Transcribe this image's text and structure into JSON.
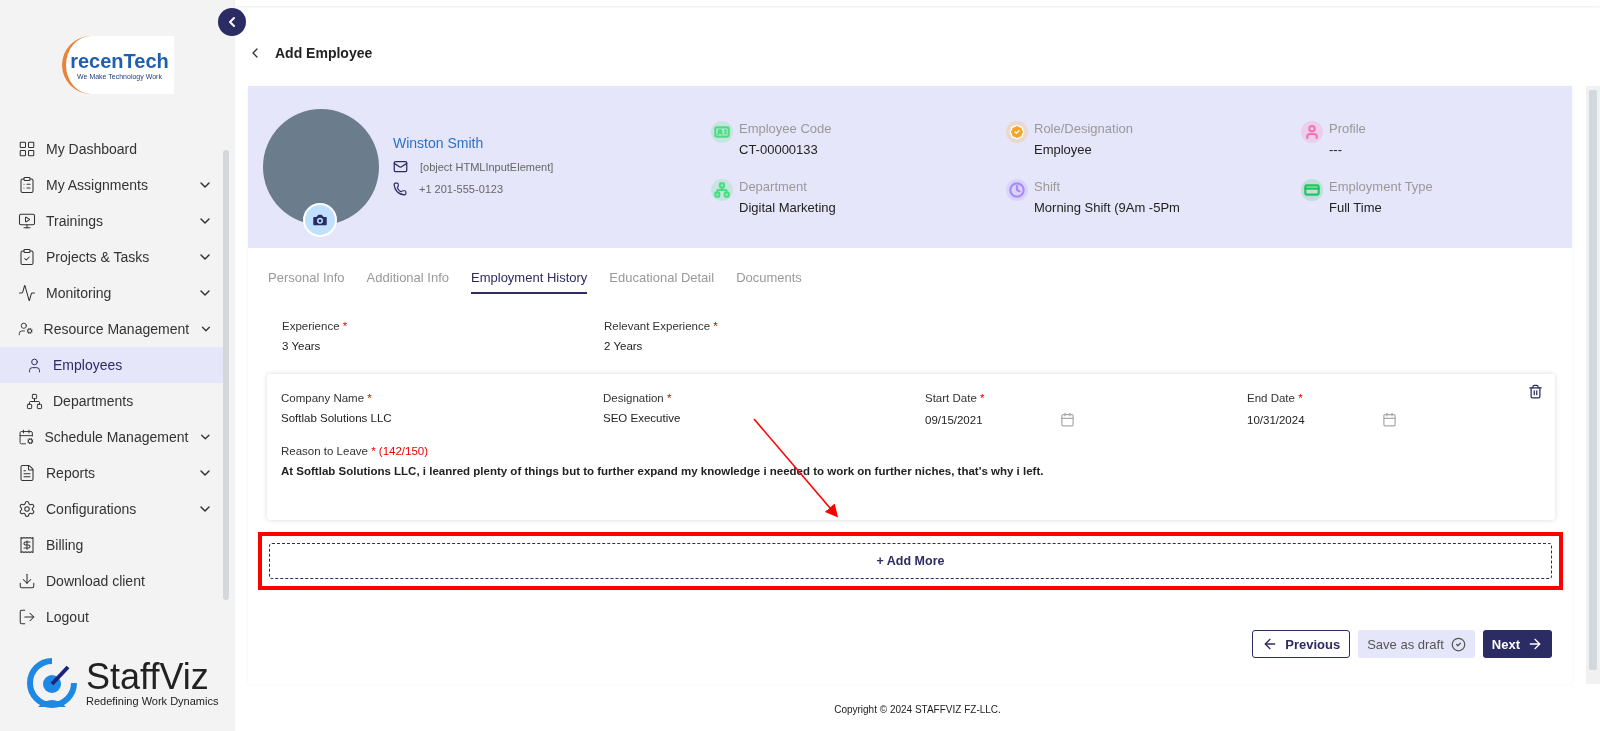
{
  "sidebar": {
    "logo": {
      "brand": "recenTech",
      "tagline": "We Make Technology Work"
    },
    "items": [
      {
        "label": "My Dashboard",
        "expandable": false,
        "selected": false
      },
      {
        "label": "My Assignments",
        "expandable": true,
        "selected": false
      },
      {
        "label": "Trainings",
        "expandable": true,
        "selected": false
      },
      {
        "label": "Projects & Tasks",
        "expandable": true,
        "selected": false
      },
      {
        "label": "Monitoring",
        "expandable": true,
        "selected": false
      },
      {
        "label": "Resource Management",
        "expandable": true,
        "expanded": true,
        "selected": false,
        "children": [
          {
            "label": "Employees",
            "selected": true
          },
          {
            "label": "Departments",
            "selected": false
          }
        ]
      },
      {
        "label": "Schedule Management",
        "expandable": true,
        "selected": false
      },
      {
        "label": "Reports",
        "expandable": true,
        "selected": false
      },
      {
        "label": "Configurations",
        "expandable": true,
        "selected": false
      },
      {
        "label": "Billing",
        "expandable": false,
        "selected": false
      },
      {
        "label": "Download client",
        "expandable": false,
        "selected": false
      },
      {
        "label": "Logout",
        "expandable": false,
        "selected": false
      }
    ],
    "footer_logo": {
      "brand": "StaffViz",
      "tagline": "Redefining Work Dynamics"
    }
  },
  "page": {
    "title": "Add Employee"
  },
  "profile": {
    "name": "Winston Smith",
    "email": "[object HTMLInputElement]",
    "phone": "+1 201-555-0123",
    "fields": [
      {
        "label": "Employee Code",
        "value": "CT-00000133",
        "color": "#4ade80"
      },
      {
        "label": "Role/Designation",
        "value": "Employee",
        "color": "#f5a524"
      },
      {
        "label": "Profile",
        "value": "---",
        "color": "#f472b6"
      },
      {
        "label": "Department",
        "value": "Digital Marketing",
        "color": "#4ade80"
      },
      {
        "label": "Shift",
        "value": "Morning Shift (9Am -5Pm",
        "color": "#a78bfa"
      },
      {
        "label": "Employment Type",
        "value": "Full Time",
        "color": "#22c55e"
      }
    ]
  },
  "tabs": [
    {
      "label": "Personal Info",
      "selected": false
    },
    {
      "label": "Additional Info",
      "selected": false
    },
    {
      "label": "Employment History",
      "selected": true
    },
    {
      "label": "Educational Detail",
      "selected": false
    },
    {
      "label": "Documents",
      "selected": false
    }
  ],
  "experience": [
    {
      "label": "Experience",
      "mark": "*",
      "value": "3 Years"
    },
    {
      "label": "Relevant Experience",
      "mark": "*",
      "value": "2 Years"
    }
  ],
  "history": [
    {
      "fields": [
        {
          "label": "Company Name",
          "mark": "*",
          "value": "Softlab Solutions LLC",
          "kind": "text"
        },
        {
          "label": "Designation",
          "mark": "*",
          "value": "SEO Executive",
          "kind": "text"
        },
        {
          "label": "Start Date",
          "mark": "*",
          "value": "09/15/2021",
          "kind": "date"
        },
        {
          "label": "End Date",
          "mark": "*",
          "value": "10/31/2024",
          "kind": "date"
        }
      ],
      "reason": {
        "label": "Reason to Leave",
        "mark": "*",
        "counter": "(142/150)",
        "value": "At Softlab Solutions LLC, i leanred plenty of things but to further expand my knowledge i needed to work on further niches, that's why i left."
      }
    }
  ],
  "add_more": "+ Add More",
  "actions": {
    "previous": "Previous",
    "draft": "Save as draft",
    "next": "Next"
  },
  "copyright": "Copyright © 2024 STAFFVIZ FZ-LLC."
}
